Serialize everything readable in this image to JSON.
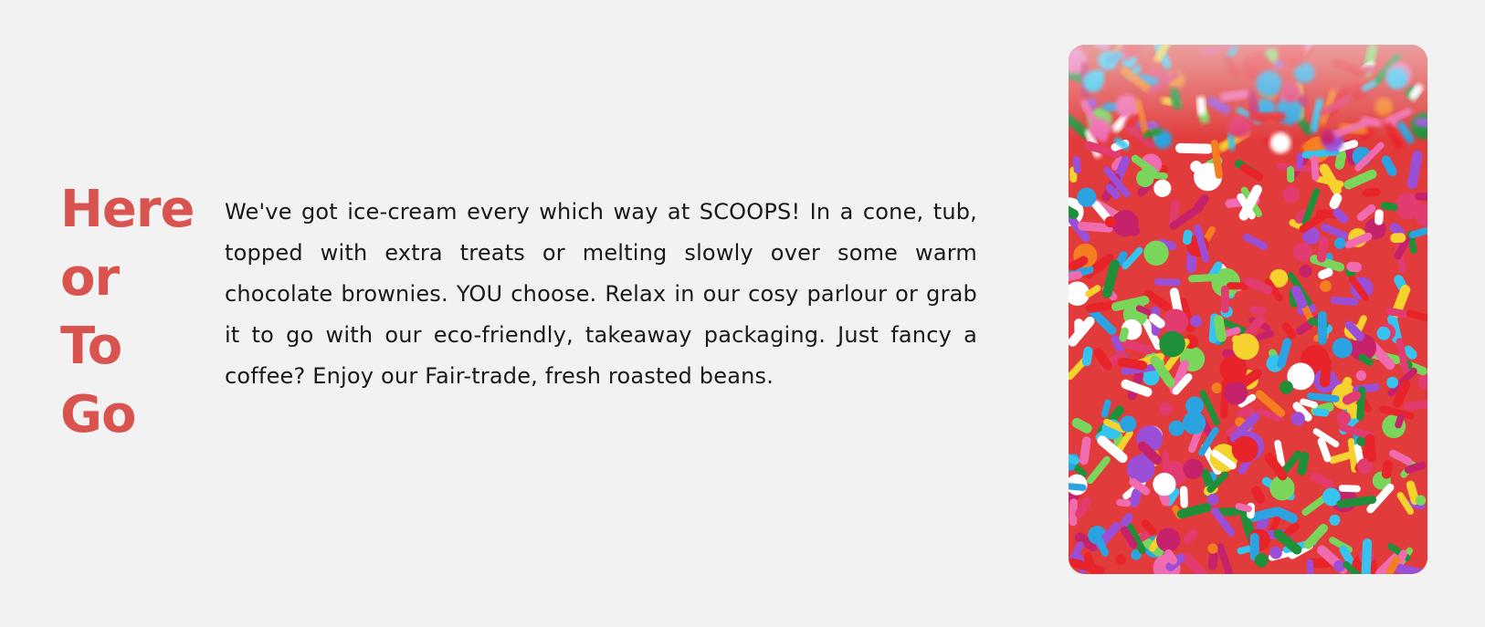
{
  "section": {
    "heading_lines": [
      "Here",
      "or",
      "To",
      "Go"
    ],
    "paragraph": "We've got ice-cream every which way at SCOOPS! In a cone, tub, topped with extra treats or melting slowly over some warm chocolate brownies. YOU choose. Relax in our cosy parlour or grab it to go with our eco-friendly, takeaway packaging. Just fancy a coffee? Enjoy our Fair-trade, fresh roasted beans.",
    "image": {
      "subject": "sprinkles-photo"
    }
  },
  "colors": {
    "background": "#f2f2f2",
    "heading": "#d9534f",
    "text": "#1a1a1a"
  }
}
